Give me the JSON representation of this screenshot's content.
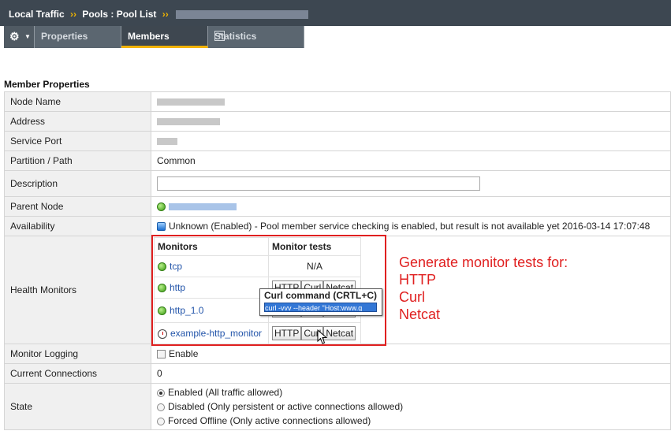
{
  "breadcrumb": {
    "part1": "Local Traffic",
    "sep": "››",
    "part2": "Pools : Pool List",
    "sep2": "››"
  },
  "tabs": {
    "properties": "Properties",
    "members": "Members",
    "statistics": "Statistics"
  },
  "section_title": "Member Properties",
  "rows": {
    "node_name": "Node Name",
    "address": "Address",
    "service_port": "Service Port",
    "partition": "Partition / Path",
    "partition_value": "Common",
    "description": "Description",
    "description_value": "",
    "parent_node": "Parent Node",
    "availability": "Availability",
    "availability_value": "Unknown (Enabled) - Pool member service checking is enabled, but result is not available yet 2016-03-14 17:07:48",
    "health_monitors": "Health Monitors",
    "monitor_logging": "Monitor Logging",
    "monitor_logging_enable": "Enable",
    "current_connections": "Current Connections",
    "current_connections_value": "0",
    "state": "State",
    "state_enabled": "Enabled (All traffic allowed)",
    "state_disabled": "Disabled (Only persistent or active connections allowed)",
    "state_forced": "Forced Offline (Only active connections allowed)"
  },
  "monitors": {
    "col_monitors": "Monitors",
    "col_tests": "Monitor tests",
    "tcp": "tcp",
    "tcp_tests": "N/A",
    "http": "http",
    "http10": "http_1.0",
    "example": "example-http_monitor",
    "btn_http": "HTTP",
    "btn_curl": "Curl",
    "btn_netcat": "Netcat"
  },
  "tooltip": {
    "title": "Curl command (CRTL+C)",
    "command": "curl -vvv --header \"Host:www.g"
  },
  "annotation": {
    "line1": "Generate monitor tests for:",
    "line2": "HTTP",
    "line3": "Curl",
    "line4": "Netcat"
  },
  "colors": {
    "accent_yellow": "#f2b300",
    "header_dark": "#3d4751",
    "annotation_red": "#e02020"
  },
  "icons": [
    "gear-icon",
    "external-link-icon",
    "status-green-icon",
    "status-blue-icon",
    "clock-icon",
    "pointer-cursor-icon"
  ]
}
